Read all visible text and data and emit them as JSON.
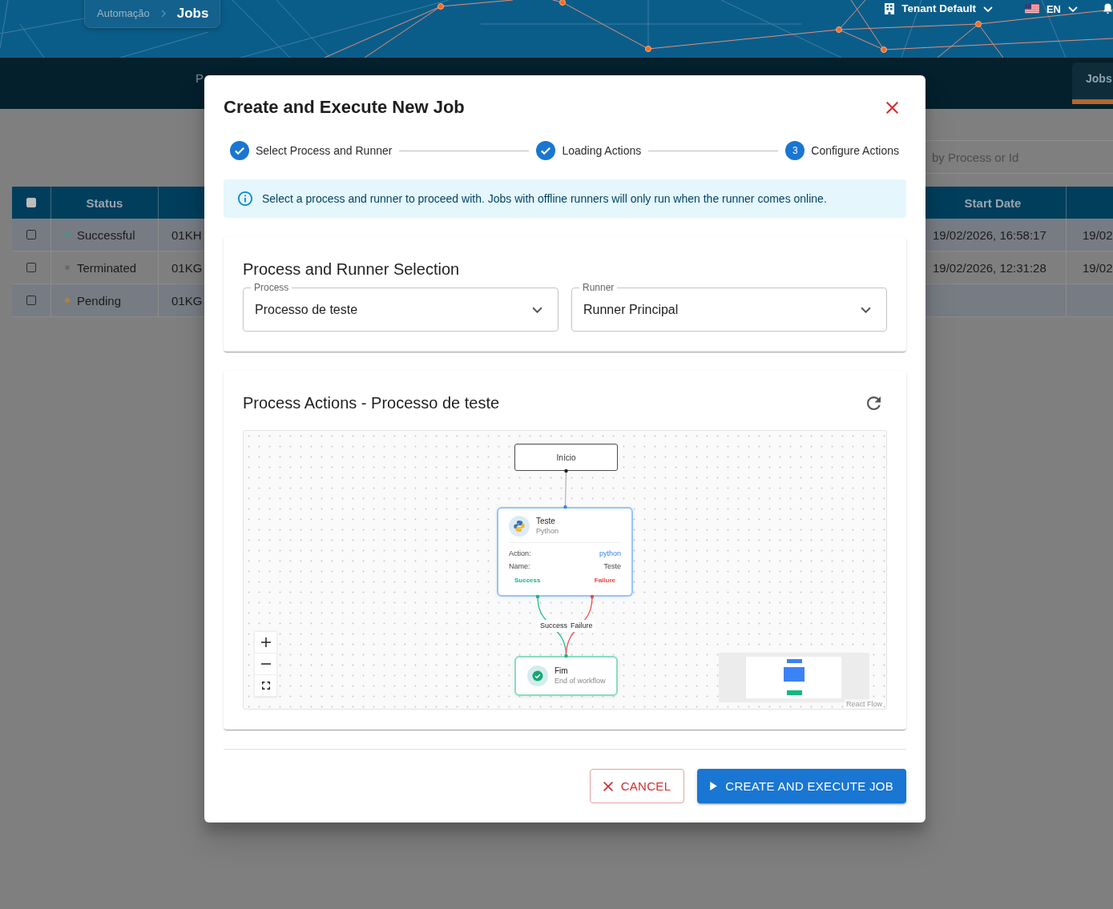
{
  "header": {
    "breadcrumb": [
      {
        "label": "Automação",
        "current": false
      },
      {
        "label": "Jobs",
        "current": true
      }
    ],
    "tenant": "Tenant Default",
    "language": "EN"
  },
  "nav": {
    "items": [
      {
        "label": "P",
        "selected": false
      },
      {
        "label": "Jobs",
        "selected": true
      }
    ]
  },
  "search": {
    "placeholder": "by Process or Id"
  },
  "table": {
    "header_checkbox": {
      "checked": false
    },
    "columns": {
      "status": "Status",
      "start_date": "Start Date"
    },
    "rows": [
      {
        "checked": false,
        "status": "Successful",
        "color": "#4e8e86",
        "column_3": "01KH",
        "start_date": "19/02/2026, 16:58:17",
        "column_last": "19/02"
      },
      {
        "checked": false,
        "status": "Terminated",
        "color": "#6b6b6b",
        "column_3": "01KG",
        "start_date": "19/02/2026, 12:31:28",
        "column_last": "19/02"
      },
      {
        "checked": false,
        "status": "Pending",
        "color": "#a8843c",
        "column_3": "01KG"
      }
    ]
  },
  "dialog": {
    "title": "Create and Execute New Job",
    "steps": [
      {
        "label": "Select Process and Runner",
        "completed": true,
        "active": false
      },
      {
        "label": "Loading Actions",
        "completed": true,
        "active": false
      },
      {
        "label": "Configure Actions",
        "completed": false,
        "active": true,
        "number": "3"
      }
    ],
    "alert": {
      "kind": "info",
      "text": "Select a process and runner to proceed with. Jobs with offline runners will only run when the runner comes online."
    },
    "selection": {
      "title": "Process and Runner Selection",
      "fields": [
        {
          "label": "Process",
          "value": "Processo de teste"
        },
        {
          "label": "Runner",
          "value": "Runner Principal"
        }
      ]
    },
    "actions_panel": {
      "title": "Process Actions - Processo de teste",
      "flow": {
        "nodes": [
          {
            "kind": "start",
            "label": "Início"
          },
          {
            "kind": "action",
            "title": "Teste",
            "subtitle": "Python",
            "fields": [
              {
                "kind": "action",
                "label": "Action:",
                "value": "python"
              },
              {
                "kind": "name",
                "label": "Name:",
                "value": "Teste"
              }
            ],
            "outputs": [
              {
                "kind": "success",
                "label": "Success"
              },
              {
                "kind": "failure",
                "label": "Failure"
              }
            ]
          },
          {
            "kind": "end",
            "title": "Fim",
            "subtitle": "End of workflow"
          }
        ],
        "edges": [
          {
            "kind": "default"
          },
          {
            "kind": "success",
            "label": "Success"
          },
          {
            "kind": "failure",
            "label": "Failure"
          }
        ]
      },
      "attribution": "React Flow"
    },
    "buttons": [
      {
        "label": "CANCEL",
        "kind": "cancel"
      },
      {
        "label": "CREATE AND EXECUTE JOB",
        "kind": "primary"
      }
    ]
  }
}
